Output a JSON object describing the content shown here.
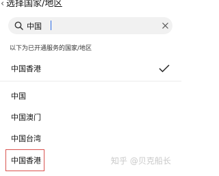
{
  "header": {
    "back_icon": "chevron-left-icon",
    "title": "选择国家/地区"
  },
  "search": {
    "value": "中国",
    "icon": "search-icon",
    "clear_icon": "close-icon"
  },
  "section_caption": "以下为已开通服务的国家/地区",
  "selected_item": {
    "label": "中国香港",
    "checked": true,
    "check_icon": "checkmark-icon"
  },
  "results": [
    {
      "label": "中国"
    },
    {
      "label": "中国澳门"
    },
    {
      "label": "中国台湾"
    },
    {
      "label": "中国香港",
      "highlighted": true
    }
  ],
  "watermark": "知乎 @贝克船长",
  "colors": {
    "highlight_border": "#d9534f",
    "search_background": "#f1f1f1",
    "caret": "#2b6be6"
  }
}
